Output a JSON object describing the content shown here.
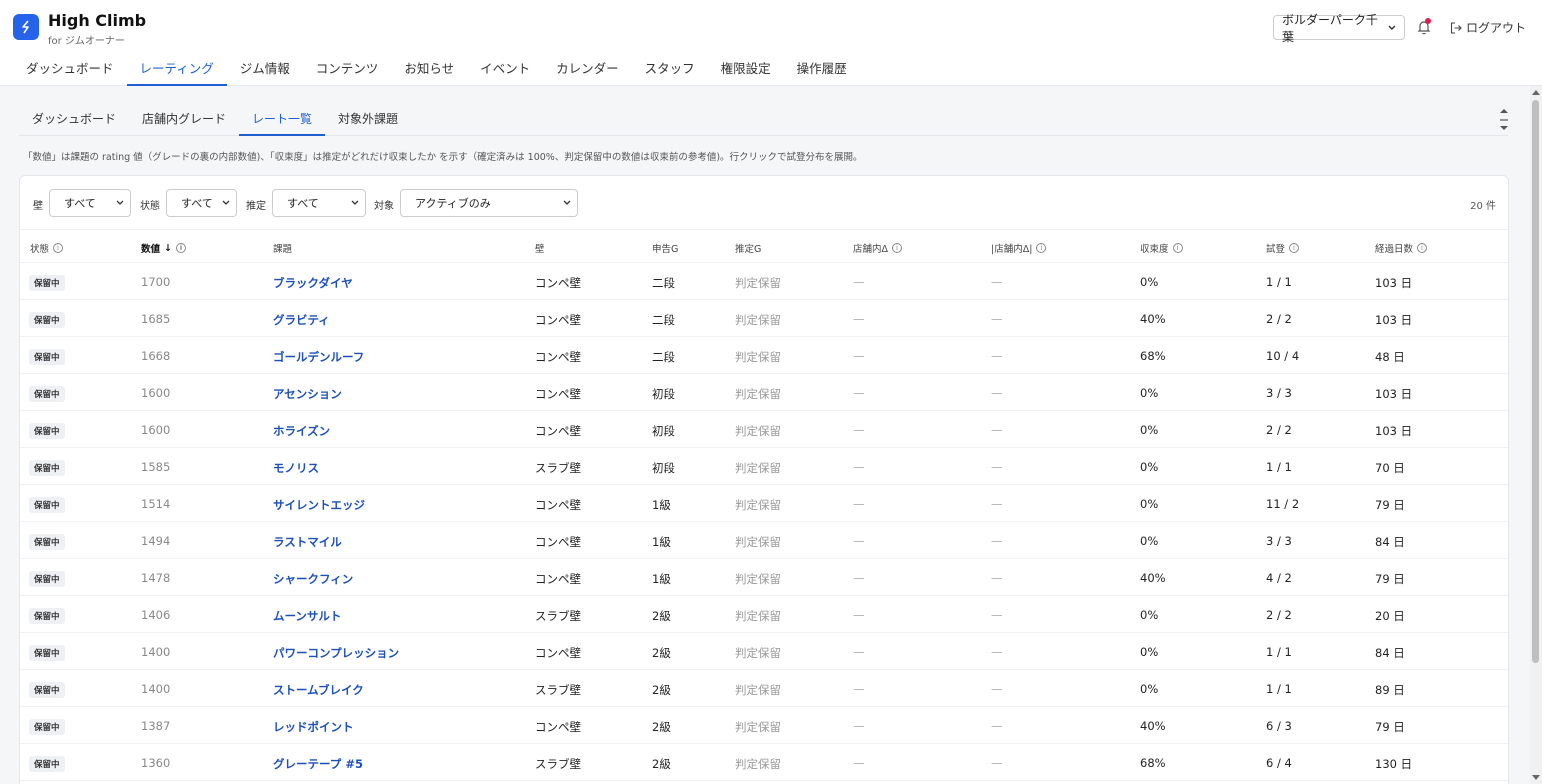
{
  "app": {
    "name": "High Climb",
    "subtitle": "for ジムオーナー"
  },
  "header": {
    "gym_select": "ボルダーパーク千葉",
    "logout_label": "ログアウト"
  },
  "main_nav": [
    {
      "label": "ダッシュボード",
      "active": false
    },
    {
      "label": "レーティング",
      "active": true
    },
    {
      "label": "ジム情報",
      "active": false
    },
    {
      "label": "コンテンツ",
      "active": false
    },
    {
      "label": "お知らせ",
      "active": false
    },
    {
      "label": "イベント",
      "active": false
    },
    {
      "label": "カレンダー",
      "active": false
    },
    {
      "label": "スタッフ",
      "active": false
    },
    {
      "label": "権限設定",
      "active": false
    },
    {
      "label": "操作履歴",
      "active": false
    }
  ],
  "sub_nav": [
    {
      "label": "ダッシュボード",
      "active": false
    },
    {
      "label": "店舗内グレード",
      "active": false
    },
    {
      "label": "レート一覧",
      "active": true
    },
    {
      "label": "対象外課題",
      "active": false
    }
  ],
  "description": "「数値」は課題の rating 値（グレードの裏の内部数値)、「収束度」は推定がどれだけ収束したか を示す（確定済みは 100%、判定保留中の数値は収束前の参考値)。行クリックで試登分布を展開。",
  "filters": {
    "wall_label": "壁",
    "wall_value": "すべて",
    "status_label": "状態",
    "status_value": "すべて",
    "estimate_label": "推定",
    "estimate_value": "すべて",
    "target_label": "対象",
    "target_value": "アクティブのみ",
    "count": "20 件"
  },
  "columns": {
    "status": "状態",
    "value": "数値",
    "problem": "課題",
    "wall": "壁",
    "declared": "申告G",
    "estimated": "推定G",
    "delta": "店舗内Δ",
    "abs_delta": "|店舗内Δ|",
    "convergence": "収束度",
    "attempts": "試登",
    "days": "経過日数"
  },
  "rows": [
    {
      "status": "保留中",
      "value": "1700",
      "name": "ブラックダイヤ",
      "wall": "コンペ壁",
      "declared": "二段",
      "estimated": "判定保留",
      "delta": "—",
      "abs_delta": "—",
      "convergence": "0%",
      "attempts": "1 / 1",
      "days": "103 日"
    },
    {
      "status": "保留中",
      "value": "1685",
      "name": "グラビティ",
      "wall": "コンペ壁",
      "declared": "二段",
      "estimated": "判定保留",
      "delta": "—",
      "abs_delta": "—",
      "convergence": "40%",
      "attempts": "2 / 2",
      "days": "103 日"
    },
    {
      "status": "保留中",
      "value": "1668",
      "name": "ゴールデンルーフ",
      "wall": "コンペ壁",
      "declared": "二段",
      "estimated": "判定保留",
      "delta": "—",
      "abs_delta": "—",
      "convergence": "68%",
      "attempts": "10 / 4",
      "days": "48 日"
    },
    {
      "status": "保留中",
      "value": "1600",
      "name": "アセンション",
      "wall": "コンペ壁",
      "declared": "初段",
      "estimated": "判定保留",
      "delta": "—",
      "abs_delta": "—",
      "convergence": "0%",
      "attempts": "3 / 3",
      "days": "103 日"
    },
    {
      "status": "保留中",
      "value": "1600",
      "name": "ホライズン",
      "wall": "コンペ壁",
      "declared": "初段",
      "estimated": "判定保留",
      "delta": "—",
      "abs_delta": "—",
      "convergence": "0%",
      "attempts": "2 / 2",
      "days": "103 日"
    },
    {
      "status": "保留中",
      "value": "1585",
      "name": "モノリス",
      "wall": "スラブ壁",
      "declared": "初段",
      "estimated": "判定保留",
      "delta": "—",
      "abs_delta": "—",
      "convergence": "0%",
      "attempts": "1 / 1",
      "days": "70 日"
    },
    {
      "status": "保留中",
      "value": "1514",
      "name": "サイレントエッジ",
      "wall": "コンペ壁",
      "declared": "1級",
      "estimated": "判定保留",
      "delta": "—",
      "abs_delta": "—",
      "convergence": "0%",
      "attempts": "11 / 2",
      "days": "79 日"
    },
    {
      "status": "保留中",
      "value": "1494",
      "name": "ラストマイル",
      "wall": "コンペ壁",
      "declared": "1級",
      "estimated": "判定保留",
      "delta": "—",
      "abs_delta": "—",
      "convergence": "0%",
      "attempts": "3 / 3",
      "days": "84 日"
    },
    {
      "status": "保留中",
      "value": "1478",
      "name": "シャークフィン",
      "wall": "コンペ壁",
      "declared": "1級",
      "estimated": "判定保留",
      "delta": "—",
      "abs_delta": "—",
      "convergence": "40%",
      "attempts": "4 / 2",
      "days": "79 日"
    },
    {
      "status": "保留中",
      "value": "1406",
      "name": "ムーンサルト",
      "wall": "スラブ壁",
      "declared": "2級",
      "estimated": "判定保留",
      "delta": "—",
      "abs_delta": "—",
      "convergence": "0%",
      "attempts": "2 / 2",
      "days": "20 日"
    },
    {
      "status": "保留中",
      "value": "1400",
      "name": "パワーコンプレッション",
      "wall": "コンペ壁",
      "declared": "2級",
      "estimated": "判定保留",
      "delta": "—",
      "abs_delta": "—",
      "convergence": "0%",
      "attempts": "1 / 1",
      "days": "84 日"
    },
    {
      "status": "保留中",
      "value": "1400",
      "name": "ストームブレイク",
      "wall": "スラブ壁",
      "declared": "2級",
      "estimated": "判定保留",
      "delta": "—",
      "abs_delta": "—",
      "convergence": "0%",
      "attempts": "1 / 1",
      "days": "89 日"
    },
    {
      "status": "保留中",
      "value": "1387",
      "name": "レッドポイント",
      "wall": "コンペ壁",
      "declared": "2級",
      "estimated": "判定保留",
      "delta": "—",
      "abs_delta": "—",
      "convergence": "40%",
      "attempts": "6 / 3",
      "days": "79 日"
    },
    {
      "status": "保留中",
      "value": "1360",
      "name": "グレーテープ #5",
      "wall": "スラブ壁",
      "declared": "2級",
      "estimated": "判定保留",
      "delta": "—",
      "abs_delta": "—",
      "convergence": "68%",
      "attempts": "6 / 4",
      "days": "130 日"
    }
  ],
  "colors": {
    "accent": "#1d5fd1",
    "brand": "#2563eb",
    "notification": "#e11d48"
  }
}
